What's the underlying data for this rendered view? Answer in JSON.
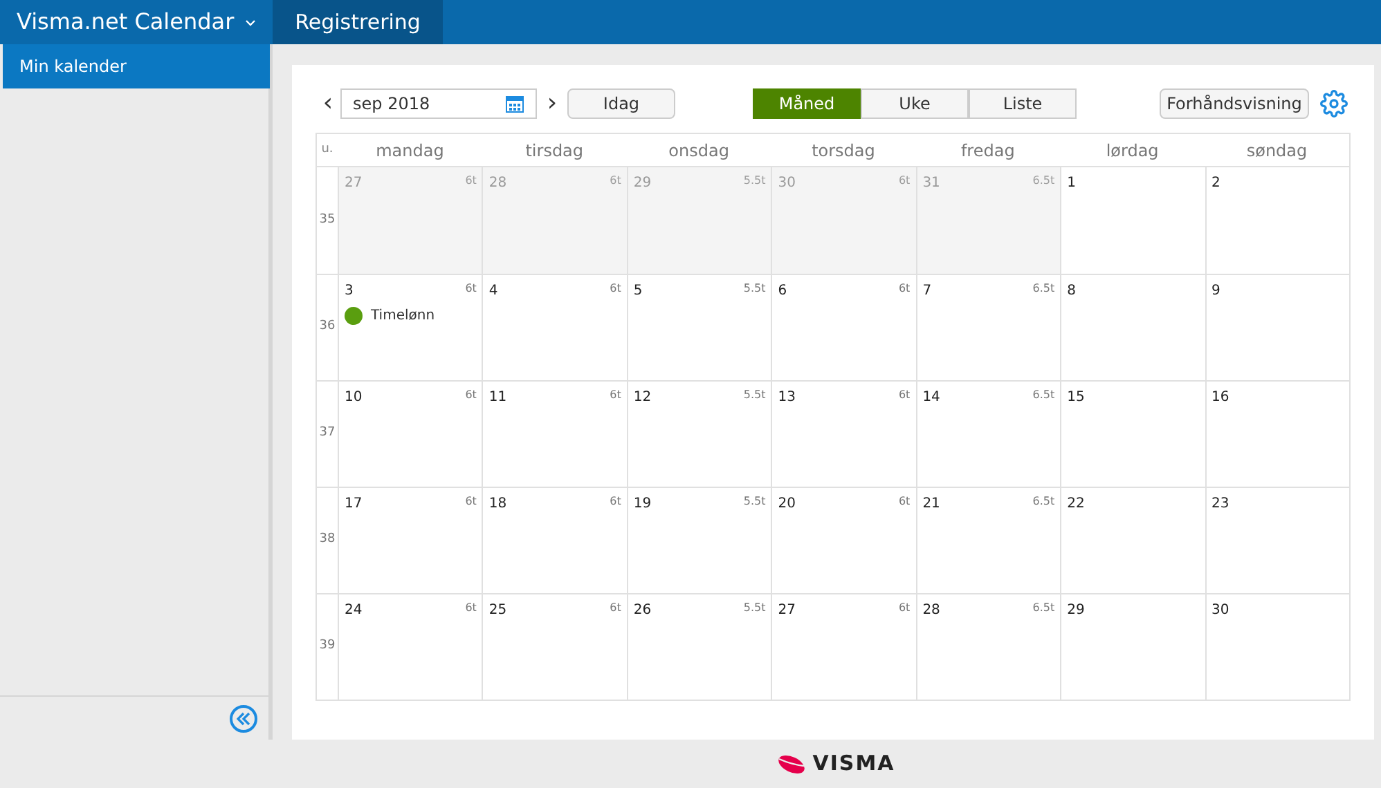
{
  "topbar": {
    "app_title": "Visma.net Calendar",
    "tabs": [
      {
        "label": "Registrering",
        "selected": true
      }
    ]
  },
  "sidebar": {
    "items": [
      {
        "label": "Min kalender",
        "selected": true
      }
    ]
  },
  "toolbar": {
    "prev": "‹",
    "date": "sep 2018",
    "next": "›",
    "today": "Idag",
    "views": [
      {
        "label": "Måned",
        "selected": true
      },
      {
        "label": "Uke",
        "selected": false
      },
      {
        "label": "Liste",
        "selected": false
      }
    ],
    "preview": "Forhåndsvisning"
  },
  "calendar": {
    "week_header": "u.",
    "days": [
      "mandag",
      "tirsdag",
      "onsdag",
      "torsdag",
      "fredag",
      "lørdag",
      "søndag"
    ],
    "weeks": [
      {
        "number": "35",
        "days": [
          {
            "date": "27",
            "hours": "6t",
            "outside": true
          },
          {
            "date": "28",
            "hours": "6t",
            "outside": true
          },
          {
            "date": "29",
            "hours": "5.5t",
            "outside": true
          },
          {
            "date": "30",
            "hours": "6t",
            "outside": true
          },
          {
            "date": "31",
            "hours": "6.5t",
            "outside": true
          },
          {
            "date": "1",
            "outside": false
          },
          {
            "date": "2",
            "outside": false
          }
        ]
      },
      {
        "number": "36",
        "days": [
          {
            "date": "3",
            "hours": "6t",
            "outside": false,
            "events": [
              {
                "label": "Timelønn",
                "color": "#5a9e0f"
              }
            ]
          },
          {
            "date": "4",
            "hours": "6t",
            "outside": false
          },
          {
            "date": "5",
            "hours": "5.5t",
            "outside": false
          },
          {
            "date": "6",
            "hours": "6t",
            "outside": false
          },
          {
            "date": "7",
            "hours": "6.5t",
            "outside": false
          },
          {
            "date": "8",
            "outside": false
          },
          {
            "date": "9",
            "outside": false
          }
        ]
      },
      {
        "number": "37",
        "days": [
          {
            "date": "10",
            "hours": "6t",
            "outside": false
          },
          {
            "date": "11",
            "hours": "6t",
            "outside": false
          },
          {
            "date": "12",
            "hours": "5.5t",
            "outside": false
          },
          {
            "date": "13",
            "hours": "6t",
            "outside": false
          },
          {
            "date": "14",
            "hours": "6.5t",
            "outside": false
          },
          {
            "date": "15",
            "outside": false
          },
          {
            "date": "16",
            "outside": false
          }
        ]
      },
      {
        "number": "38",
        "days": [
          {
            "date": "17",
            "hours": "6t",
            "outside": false
          },
          {
            "date": "18",
            "hours": "6t",
            "outside": false
          },
          {
            "date": "19",
            "hours": "5.5t",
            "outside": false
          },
          {
            "date": "20",
            "hours": "6t",
            "outside": false
          },
          {
            "date": "21",
            "hours": "6.5t",
            "outside": false
          },
          {
            "date": "22",
            "outside": false
          },
          {
            "date": "23",
            "outside": false
          }
        ]
      },
      {
        "number": "39",
        "days": [
          {
            "date": "24",
            "hours": "6t",
            "outside": false
          },
          {
            "date": "25",
            "hours": "6t",
            "outside": false
          },
          {
            "date": "26",
            "hours": "5.5t",
            "outside": false
          },
          {
            "date": "27",
            "hours": "6t",
            "outside": false
          },
          {
            "date": "28",
            "hours": "6.5t",
            "outside": false
          },
          {
            "date": "29",
            "outside": false
          },
          {
            "date": "30",
            "outside": false
          }
        ]
      }
    ]
  },
  "footer": {
    "brand": "VISMA"
  }
}
